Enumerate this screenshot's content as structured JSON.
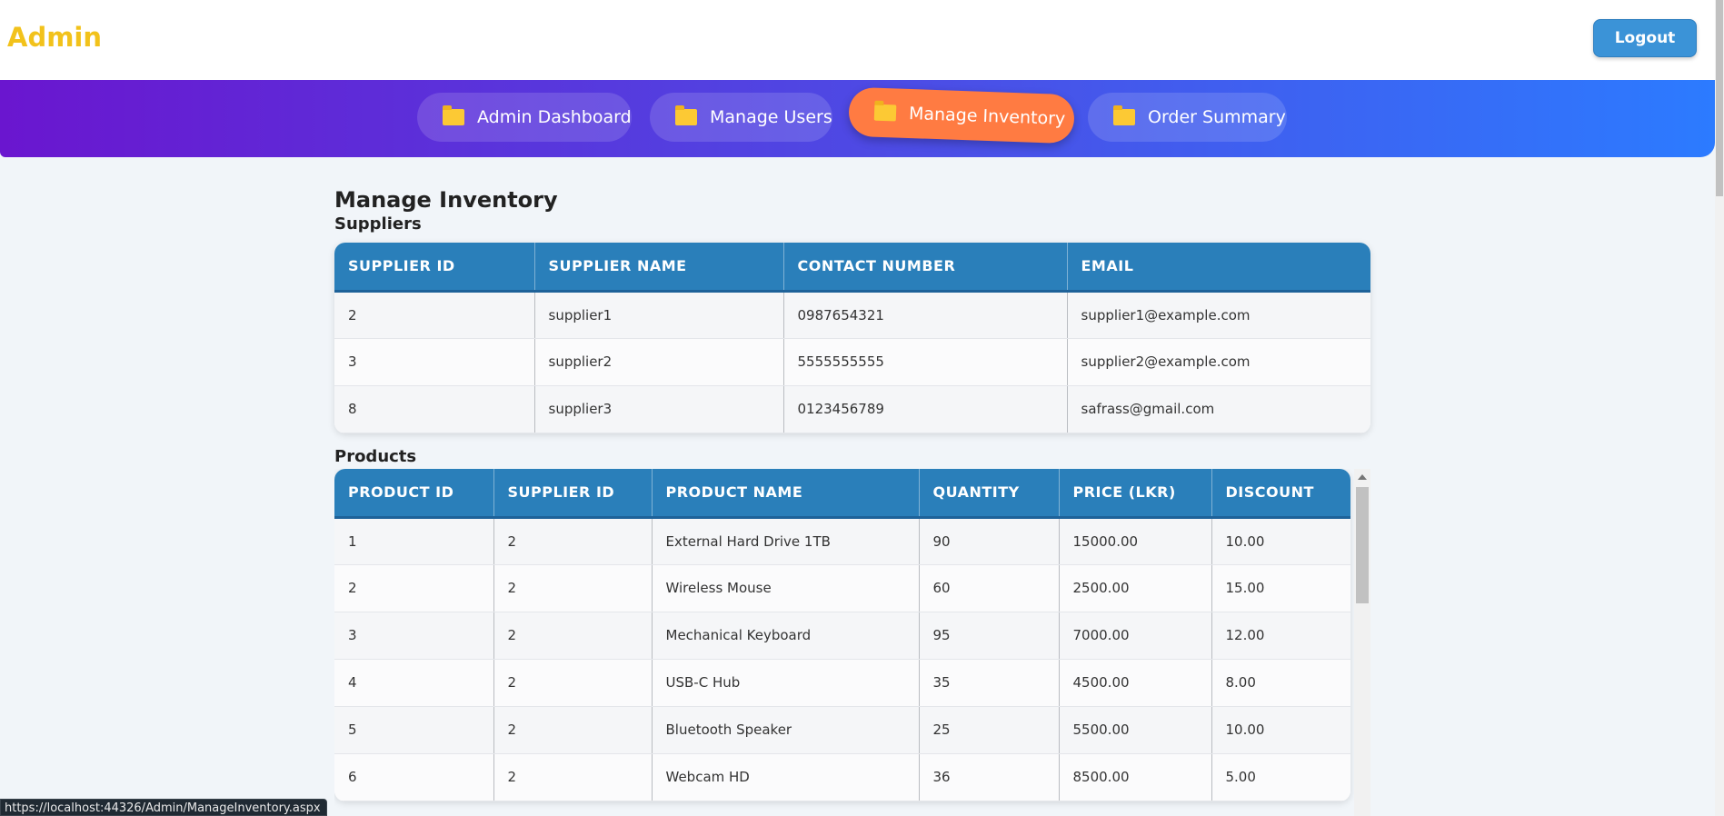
{
  "header": {
    "brand": "Admin",
    "logout_label": "Logout"
  },
  "nav": {
    "items": [
      {
        "label": "Admin Dashboard"
      },
      {
        "label": "Manage Users"
      },
      {
        "label": "Manage Inventory"
      },
      {
        "label": "Order Summary"
      }
    ],
    "active": "Manage Inventory"
  },
  "main": {
    "title": "Manage Inventory",
    "suppliers": {
      "title": "Suppliers",
      "columns": [
        "SUPPLIER ID",
        "SUPPLIER NAME",
        "CONTACT NUMBER",
        "EMAIL"
      ],
      "rows": [
        [
          "2",
          "supplier1",
          "0987654321",
          "supplier1@example.com"
        ],
        [
          "3",
          "supplier2",
          "5555555555",
          "supplier2@example.com"
        ],
        [
          "8",
          "supplier3",
          "0123456789",
          "safrass@gmail.com"
        ]
      ]
    },
    "products": {
      "title": "Products",
      "columns": [
        "PRODUCT ID",
        "SUPPLIER ID",
        "PRODUCT NAME",
        "QUANTITY",
        "PRICE (LKR)",
        "DISCOUNT"
      ],
      "rows": [
        [
          "1",
          "2",
          "External Hard Drive 1TB",
          "90",
          "15000.00",
          "10.00"
        ],
        [
          "2",
          "2",
          "Wireless Mouse",
          "60",
          "2500.00",
          "15.00"
        ],
        [
          "3",
          "2",
          "Mechanical Keyboard",
          "95",
          "7000.00",
          "12.00"
        ],
        [
          "4",
          "2",
          "USB-C Hub",
          "35",
          "4500.00",
          "8.00"
        ],
        [
          "5",
          "2",
          "Bluetooth Speaker",
          "25",
          "5500.00",
          "10.00"
        ],
        [
          "6",
          "2",
          "Webcam HD",
          "36",
          "8500.00",
          "5.00"
        ]
      ]
    }
  },
  "status_url": "https://localhost:44326/Admin/ManageInventory.aspx",
  "colors": {
    "brand": "#f2c21b",
    "header_blue": "#2a7fba",
    "active_tab": "#ff7b42"
  }
}
